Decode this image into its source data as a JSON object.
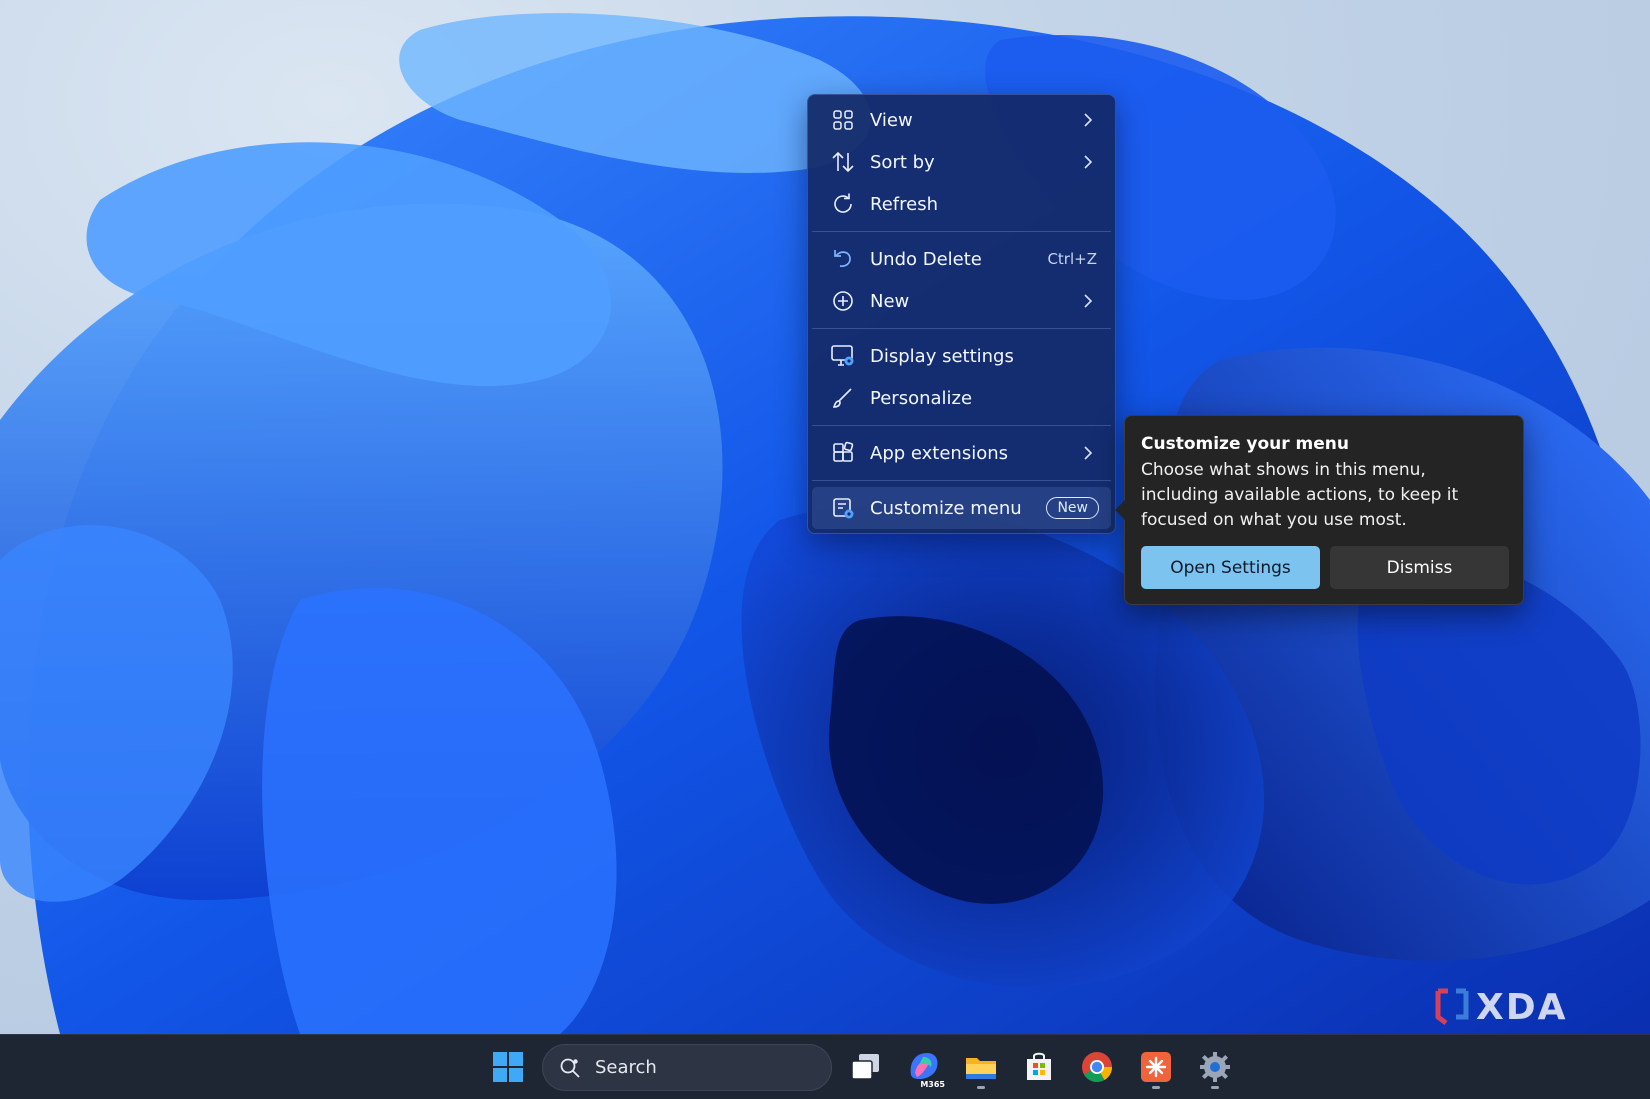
{
  "context_menu": {
    "items": [
      {
        "label": "View",
        "icon": "grid-view-icon",
        "has_submenu": true
      },
      {
        "label": "Sort by",
        "icon": "sort-icon",
        "has_submenu": true
      },
      {
        "label": "Refresh",
        "icon": "refresh-icon",
        "has_submenu": false
      },
      {
        "label": "Undo Delete",
        "icon": "undo-icon",
        "shortcut": "Ctrl+Z"
      },
      {
        "label": "New",
        "icon": "plus-circle-icon",
        "has_submenu": true
      },
      {
        "label": "Display settings",
        "icon": "display-settings-icon"
      },
      {
        "label": "Personalize",
        "icon": "brush-icon"
      },
      {
        "label": "App extensions",
        "icon": "app-extensions-icon",
        "has_submenu": true
      },
      {
        "label": "Customize menu",
        "icon": "customize-menu-icon",
        "badge": "New",
        "highlighted": true
      }
    ]
  },
  "teaching_tip": {
    "title": "Customize your menu",
    "body": "Choose what shows in this menu, including available actions, to keep it focused on what you use most.",
    "primary_button": "Open Settings",
    "secondary_button": "Dismiss"
  },
  "taskbar": {
    "search_placeholder": "Search",
    "apps": [
      "windows-start-icon",
      "task-view-icon",
      "m365-copilot-icon",
      "file-explorer-icon",
      "microsoft-store-icon",
      "chrome-icon",
      "app-orange-icon",
      "settings-gear-icon"
    ],
    "m365_label": "M365"
  },
  "watermark": "XDA",
  "colors": {
    "menu_bg": "#142a69",
    "tip_bg": "#242424",
    "primary_button": "#7cc3ef",
    "taskbar_bg": "#1f2633"
  }
}
